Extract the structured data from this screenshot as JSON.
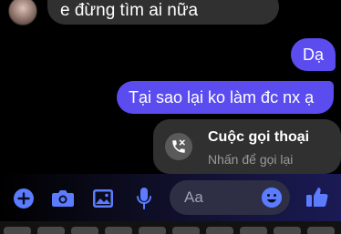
{
  "thread": {
    "incoming": {
      "text": "e đừng tìm ai nữa"
    },
    "outgoing": [
      {
        "text": "Dạ"
      },
      {
        "text": "Tại sao lại ko làm đc nx ạ"
      }
    ],
    "call_card": {
      "title": "Cuộc gọi thoại",
      "subtitle": "Nhấn để gọi lại",
      "icon": "missed-call-icon"
    }
  },
  "composer": {
    "placeholder": "Aa",
    "icons": [
      "plus-icon",
      "camera-icon",
      "image-icon",
      "microphone-icon",
      "emoji-icon",
      "like-thumb-icon"
    ]
  },
  "colors": {
    "accent": "#5b4cf0",
    "incoming_bubble": "#303030",
    "icon_blue": "#5b7cff"
  }
}
